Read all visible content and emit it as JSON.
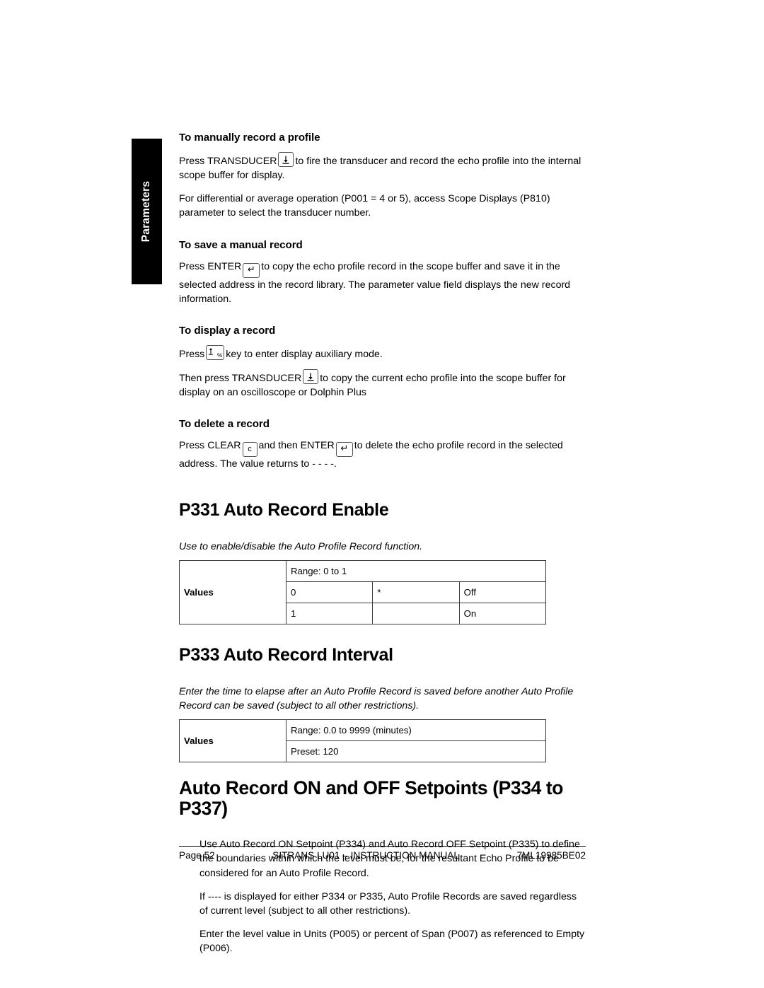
{
  "side_tab": {
    "label": "Parameters"
  },
  "sections": {
    "manual_record": {
      "heading": "To manually record a profile",
      "para1_before": "Press TRANSDUCER",
      "para1_after": "to fire the transducer and record the echo profile into the internal scope buffer for display.",
      "para2": "For differential or average operation (P001 = 4 or 5), access Scope Displays (P810) parameter to select the transducer number."
    },
    "save_record": {
      "heading": "To save a manual record",
      "para_before": "Press ENTER",
      "para_after": "to copy the echo profile record in the scope buffer and save it in the selected address in the record library. The parameter value field displays the new record information."
    },
    "display_record": {
      "heading": "To display a record",
      "para1_before": "Press",
      "para1_after": "key to enter display auxiliary mode.",
      "para2_before": "Then press TRANSDUCER",
      "para2_after": "to copy the current echo profile into the scope buffer for display on an oscilloscope or Dolphin Plus"
    },
    "delete_record": {
      "heading": "To delete a record",
      "para_before": "Press CLEAR",
      "para_mid": "and then ENTER",
      "para_after": "to delete the echo profile record in the selected address. The value returns to - - - -."
    }
  },
  "p331": {
    "heading": "P331 Auto Record Enable",
    "description": "Use to enable/disable the Auto Profile Record function.",
    "table": {
      "values_label": "Values",
      "range": "Range: 0 to 1",
      "rows": [
        {
          "num": "0",
          "star": "*",
          "desc": "Off"
        },
        {
          "num": "1",
          "star": "",
          "desc": "On"
        }
      ]
    }
  },
  "p333": {
    "heading": "P333 Auto Record Interval",
    "description": "Enter the time to elapse after an Auto Profile Record is saved before another Auto Profile Record can be saved (subject to all other restrictions).",
    "table": {
      "values_label": "Values",
      "range": "Range: 0.0 to 9999 (minutes)",
      "preset": "Preset: 120"
    }
  },
  "setpoints": {
    "heading": "Auto Record ON and OFF Setpoints (P334 to P337)",
    "para1": "Use Auto Record ON Setpoint (P334) and Auto Record OFF Setpoint (P335) to define the boundaries within which the level must be, for the resultant Echo Profile to be considered for an Auto Profile Record.",
    "para2": "If ---- is displayed for either P334 or P335, Auto Profile Records are saved regardless of current level (subject to all other restrictions).",
    "para3": "Enter the level value in Units (P005) or percent of Span (P007) as referenced to Empty (P006)."
  },
  "footer": {
    "page": "Page 52",
    "title": "SITRANS LU01 – INSTRUCTION MANUAL",
    "doc_number": "7ML19985BE02"
  },
  "icons": {
    "transducer_key": "transducer-key-icon",
    "enter_key": "enter-key-icon",
    "clear_key": "clear-key-icon",
    "display_key": "display-key-icon",
    "enter_glyph": "↵",
    "clear_glyph": "c",
    "percent_glyph": "%"
  }
}
